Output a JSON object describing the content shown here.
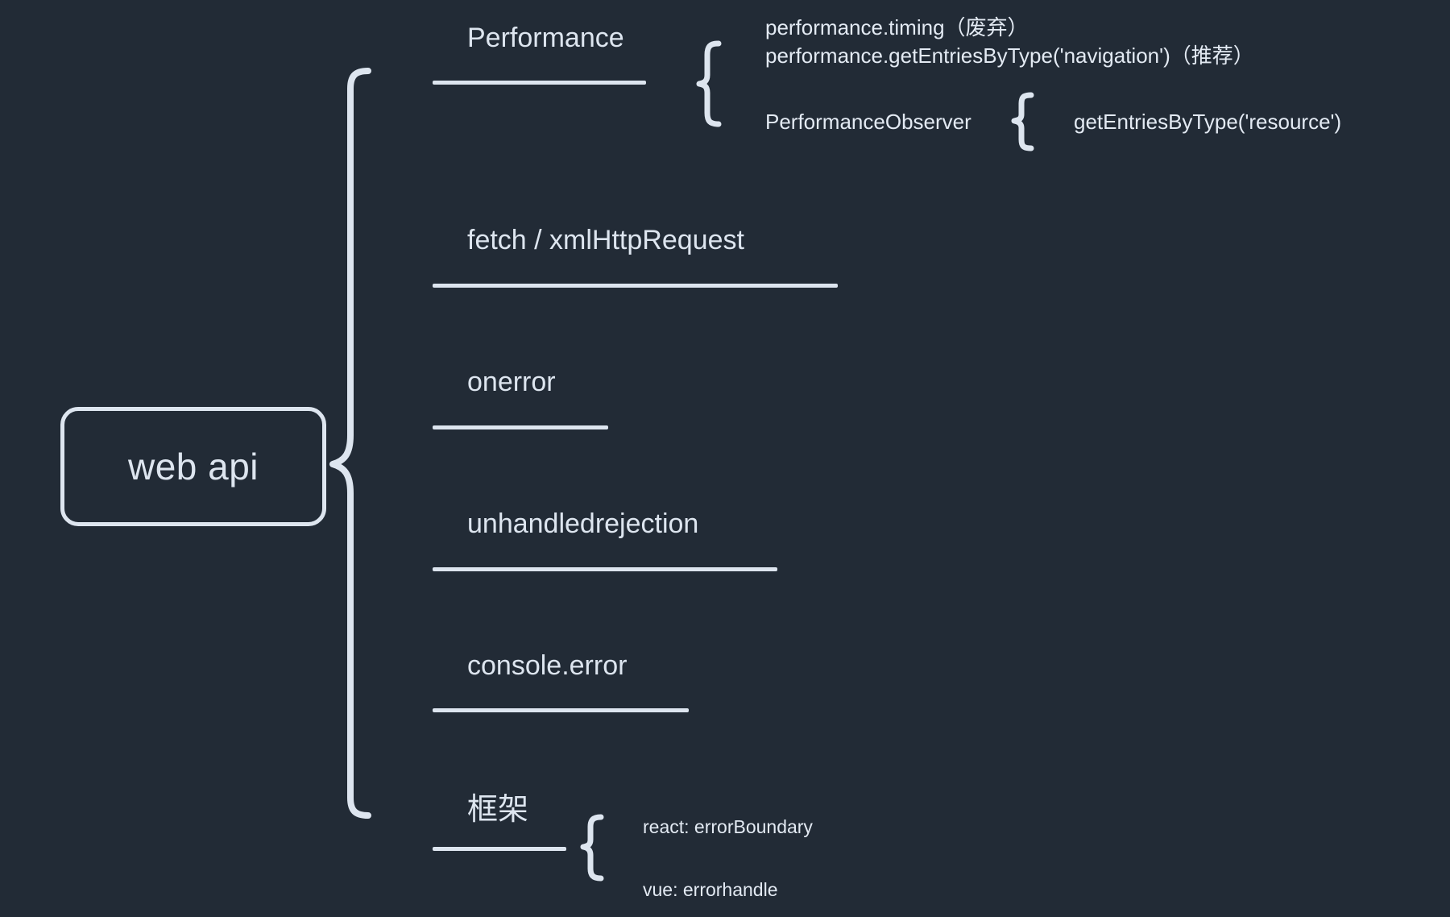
{
  "diagram": {
    "title_node": "web api",
    "background_color": "#222b36",
    "stroke_color": "#dde5ef",
    "text_color": "#dde5ef",
    "root": {
      "label": "web api"
    },
    "branches": [
      {
        "id": "performance",
        "label": "Performance",
        "children": [
          {
            "id": "performance-timing",
            "label": "performance.timing（废弃）"
          },
          {
            "id": "performance-getentriesbytype-navigation",
            "label": "performance.getEntriesByType('navigation')（推荐）"
          },
          {
            "id": "performance-observer",
            "label": "PerformanceObserver",
            "children": [
              {
                "id": "get-entries-by-type-resource",
                "label": "getEntriesByType('resource')"
              }
            ]
          }
        ]
      },
      {
        "id": "fetch-xhr",
        "label": "fetch / xmlHttpRequest",
        "children": []
      },
      {
        "id": "onerror",
        "label": "onerror",
        "children": []
      },
      {
        "id": "unhandledrejection",
        "label": "unhandledrejection",
        "children": []
      },
      {
        "id": "console-error",
        "label": "console.error",
        "children": []
      },
      {
        "id": "framework",
        "label": "框架",
        "children": [
          {
            "id": "react-error-boundary",
            "label": "react: errorBoundary"
          },
          {
            "id": "vue-errorhandle",
            "label": "vue: errorhandle"
          }
        ]
      }
    ]
  }
}
